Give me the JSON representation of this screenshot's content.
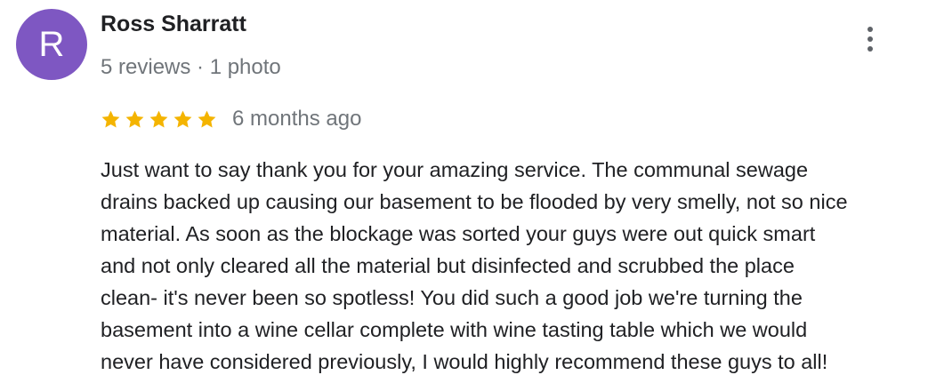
{
  "reviewer": {
    "avatar_letter": "R",
    "avatar_color": "#7e57c2",
    "name": "Ross Sharratt",
    "meta": "5 reviews · 1 photo"
  },
  "review": {
    "rating": 5,
    "max_rating": 5,
    "star_color": "#f4b400",
    "date": "6 months ago",
    "text": "Just want to say thank you for your amazing service.  The communal sewage\ndrains backed up causing our basement to be flooded by very smelly, not so nice\nmaterial.  As soon as the blockage was sorted your guys were out quick smart\nand not only cleared all the material but disinfected and scrubbed the place\nclean- it's never been so spotless!  You did such a good job we're turning the\nbasement into a wine cellar complete with wine tasting table which we would\nnever have considered previously,  I would highly recommend these guys to all!"
  },
  "actions": {
    "more_icon": "more-vert-icon"
  }
}
